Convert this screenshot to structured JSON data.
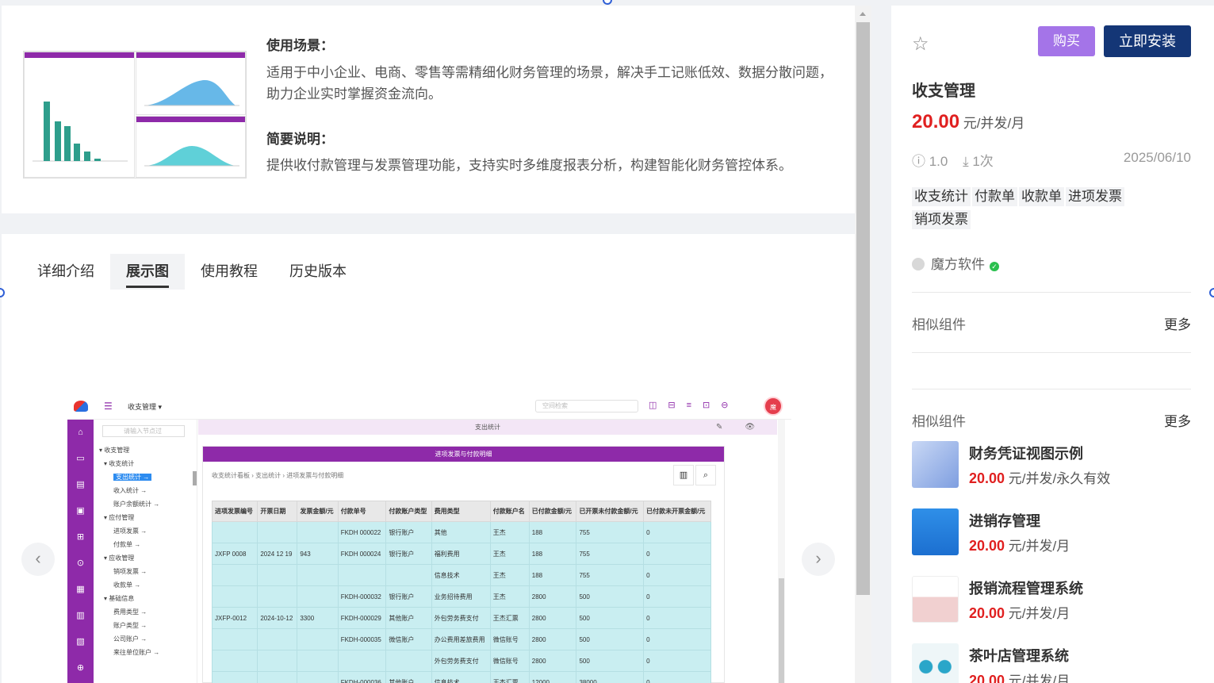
{
  "intro": {
    "scene_title": "使用场景：",
    "scene_text": "适用于中小企业、电商、零售等需精细化财务管理的场景，解决手工记账低效、数据分散问题，助力企业实时掌握资金流向。",
    "brief_title": "简要说明：",
    "brief_text": "提供收付款管理与发票管理功能，支持实时多维度报表分析，构建智能化财务管控体系。"
  },
  "tabs": [
    "详细介绍",
    "展示图",
    "使用教程",
    "历史版本"
  ],
  "active_tab": "展示图",
  "carousel": {
    "prev": "‹",
    "next": "›"
  },
  "screenshot": {
    "menu_icon": "☰",
    "app_title": "收支管理 ▾",
    "search_placeholder": "空间检索",
    "top_icons": "◫⊟≡⊡⊖",
    "avatar": "魔",
    "sidebar_icons": [
      "⌂",
      "▭",
      "▤",
      "▣",
      "⊞",
      "⊙",
      "▦",
      "▥",
      "▧",
      "⊕"
    ],
    "tree_search": "请输入节点过",
    "tree": [
      "▾ 收支管理",
      "  ▾ 收支统计",
      "      支出统计  →",
      "      收入统计  →",
      "      账户余额统计  →",
      "  ▾ 应付管理",
      "      进项发票  →",
      "      付款单  →",
      "  ▾ 应收管理",
      "      销项发票  →",
      "      收款单  →",
      "  ▾ 基础信息",
      "      费用类型  →",
      "      账户类型  →",
      "      公司账户  →",
      "      来往单位账户  →"
    ],
    "tree_selected_index": 2,
    "strip_title": "支出统计",
    "panel_title": "进项发票与付款明细",
    "breadcrumb": "收支统计看板  ›  支出统计  ›  进项发票与付款明细",
    "tool_icons": [
      "▥",
      "⌕"
    ],
    "table": {
      "headers": [
        "进项发票编号",
        "开票日期",
        "发票金额/元",
        "付款单号",
        "付款账户类型",
        "费用类型",
        "付款账户名",
        "已付款金额/元",
        "已开票未付款金额/元",
        "已付款未开票金额/元"
      ],
      "rows": [
        [
          "",
          "",
          "",
          "FKDH 000022",
          "银行账户",
          "其他",
          "王杰",
          "188",
          "755",
          "0"
        ],
        [
          "JXFP 0008",
          "2024 12 19",
          "943",
          "FKDH 000024",
          "银行账户",
          "福利费用",
          "王杰",
          "188",
          "755",
          "0"
        ],
        [
          "",
          "",
          "",
          "",
          "",
          "信息技术",
          "王杰",
          "188",
          "755",
          "0"
        ],
        [
          "",
          "",
          "",
          "FKDH-000032",
          "银行账户",
          "业务招待费用",
          "王杰",
          "2800",
          "500",
          "0"
        ],
        [
          "JXFP-0012",
          "2024-10-12",
          "3300",
          "FKDH-000029",
          "其他账户",
          "外包劳务费支付",
          "王杰汇票",
          "2800",
          "500",
          "0"
        ],
        [
          "",
          "",
          "",
          "FKDH-000035",
          "微信账户",
          "办公费用差旅费用",
          "微信账号",
          "2800",
          "500",
          "0"
        ],
        [
          "",
          "",
          "",
          "",
          "",
          "外包劳务费支付",
          "微信账号",
          "2800",
          "500",
          "0"
        ],
        [
          "",
          "",
          "",
          "FKDH-000036",
          "其他账户",
          "信息技术",
          "王杰汇票",
          "12000",
          "38000",
          "0"
        ]
      ]
    }
  },
  "sidebar": {
    "favorite_icon": "star-outline",
    "buy_label": "购买",
    "install_label": "立即安装",
    "title": "收支管理",
    "price": "20.00",
    "price_unit": " 元/并发/月",
    "version": "ⓘ 1.0",
    "downloads": "⤓ 1次",
    "date": "2025/06/10",
    "tags": [
      "收支统计",
      "付款单",
      "收款单",
      "进项发票",
      "销项发票"
    ],
    "author": "魔方软件",
    "similar_title": "相似组件",
    "more_label": "更多",
    "similar_title_2": "相似组件",
    "more_label_2": "更多",
    "related": [
      {
        "name": "财务凭证视图示例",
        "price": "20.00",
        "unit": " 元/并发/永久有效"
      },
      {
        "name": "进销存管理",
        "price": "20.00",
        "unit": " 元/并发/月"
      },
      {
        "name": "报销流程管理系统",
        "price": "20.00",
        "unit": " 元/并发/月"
      },
      {
        "name": "茶叶店管理系统",
        "price": "20.00",
        "unit": " 元/并发/月"
      }
    ]
  },
  "colors": {
    "accent": "#8e2aa9",
    "price": "#e02020",
    "install": "#143676",
    "buy": "#a474e8"
  }
}
